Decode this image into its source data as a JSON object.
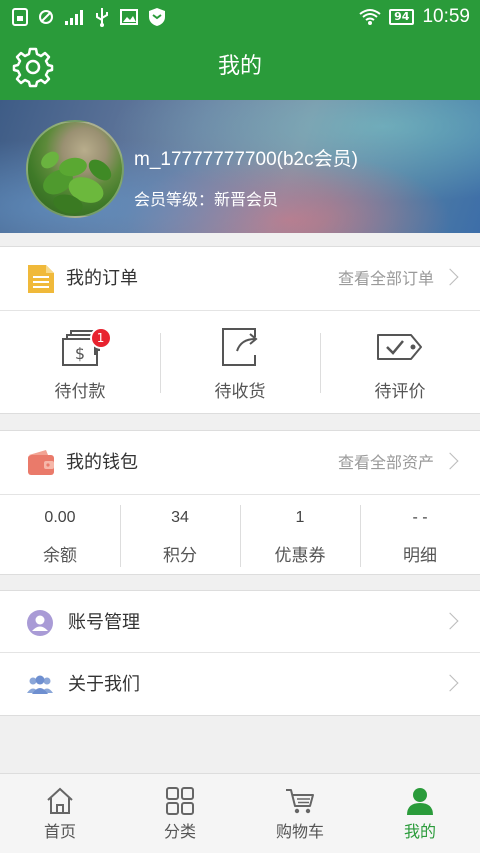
{
  "status_bar": {
    "time": "10:59",
    "battery": "94"
  },
  "app_bar": {
    "title": "我的"
  },
  "profile": {
    "username": "m_17777777700(b2c会员)",
    "member_level": "会员等级：新晋会员"
  },
  "orders": {
    "title": "我的订单",
    "view_all": "查看全部订单",
    "items": [
      {
        "label": "待付款",
        "badge": "1",
        "icon": "payment-pending-icon"
      },
      {
        "label": "待收货",
        "icon": "package-receive-icon"
      },
      {
        "label": "待评价",
        "icon": "review-tag-icon"
      }
    ]
  },
  "wallet": {
    "title": "我的钱包",
    "view_all": "查看全部资产",
    "items": [
      {
        "value": "0.00",
        "label": "余额"
      },
      {
        "value": "34",
        "label": "积分"
      },
      {
        "value": "1",
        "label": "优惠券"
      },
      {
        "value": "- -",
        "label": "明细"
      }
    ]
  },
  "menu": {
    "account": "账号管理",
    "about": "关于我们"
  },
  "tabs": [
    {
      "label": "首页",
      "icon": "home-icon"
    },
    {
      "label": "分类",
      "icon": "category-grid-icon"
    },
    {
      "label": "购物车",
      "icon": "cart-icon"
    },
    {
      "label": "我的",
      "icon": "user-icon",
      "active": true
    }
  ],
  "colors": {
    "primary": "#2a9b3a",
    "badge": "#e8232f",
    "order_icon": "#f0b93a",
    "wallet_icon": "#ea7a6a",
    "menu_icon": "#a99bd6"
  }
}
